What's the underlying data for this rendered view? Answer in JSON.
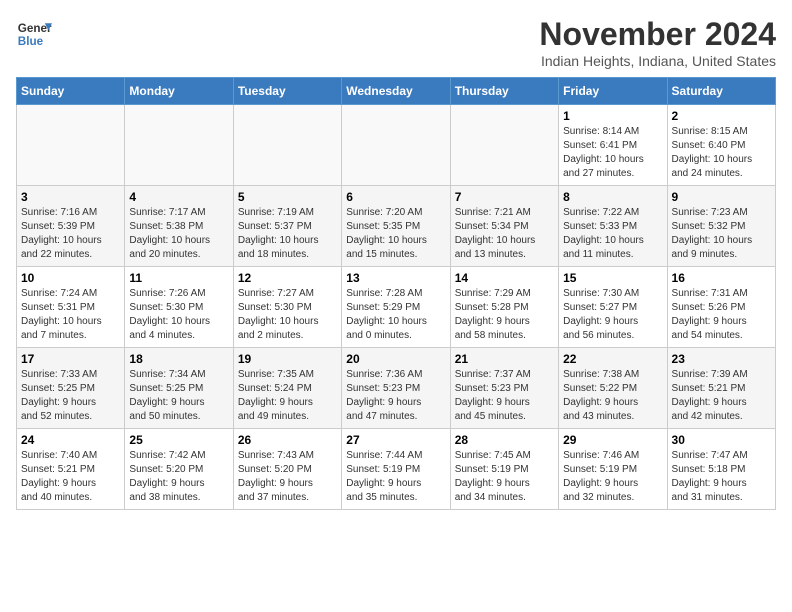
{
  "header": {
    "logo": {
      "line1": "General",
      "line2": "Blue"
    },
    "title": "November 2024",
    "location": "Indian Heights, Indiana, United States"
  },
  "weekdays": [
    "Sunday",
    "Monday",
    "Tuesday",
    "Wednesday",
    "Thursday",
    "Friday",
    "Saturday"
  ],
  "weeks": [
    [
      {
        "day": "",
        "info": ""
      },
      {
        "day": "",
        "info": ""
      },
      {
        "day": "",
        "info": ""
      },
      {
        "day": "",
        "info": ""
      },
      {
        "day": "",
        "info": ""
      },
      {
        "day": "1",
        "info": "Sunrise: 8:14 AM\nSunset: 6:41 PM\nDaylight: 10 hours\nand 27 minutes."
      },
      {
        "day": "2",
        "info": "Sunrise: 8:15 AM\nSunset: 6:40 PM\nDaylight: 10 hours\nand 24 minutes."
      }
    ],
    [
      {
        "day": "3",
        "info": "Sunrise: 7:16 AM\nSunset: 5:39 PM\nDaylight: 10 hours\nand 22 minutes."
      },
      {
        "day": "4",
        "info": "Sunrise: 7:17 AM\nSunset: 5:38 PM\nDaylight: 10 hours\nand 20 minutes."
      },
      {
        "day": "5",
        "info": "Sunrise: 7:19 AM\nSunset: 5:37 PM\nDaylight: 10 hours\nand 18 minutes."
      },
      {
        "day": "6",
        "info": "Sunrise: 7:20 AM\nSunset: 5:35 PM\nDaylight: 10 hours\nand 15 minutes."
      },
      {
        "day": "7",
        "info": "Sunrise: 7:21 AM\nSunset: 5:34 PM\nDaylight: 10 hours\nand 13 minutes."
      },
      {
        "day": "8",
        "info": "Sunrise: 7:22 AM\nSunset: 5:33 PM\nDaylight: 10 hours\nand 11 minutes."
      },
      {
        "day": "9",
        "info": "Sunrise: 7:23 AM\nSunset: 5:32 PM\nDaylight: 10 hours\nand 9 minutes."
      }
    ],
    [
      {
        "day": "10",
        "info": "Sunrise: 7:24 AM\nSunset: 5:31 PM\nDaylight: 10 hours\nand 7 minutes."
      },
      {
        "day": "11",
        "info": "Sunrise: 7:26 AM\nSunset: 5:30 PM\nDaylight: 10 hours\nand 4 minutes."
      },
      {
        "day": "12",
        "info": "Sunrise: 7:27 AM\nSunset: 5:30 PM\nDaylight: 10 hours\nand 2 minutes."
      },
      {
        "day": "13",
        "info": "Sunrise: 7:28 AM\nSunset: 5:29 PM\nDaylight: 10 hours\nand 0 minutes."
      },
      {
        "day": "14",
        "info": "Sunrise: 7:29 AM\nSunset: 5:28 PM\nDaylight: 9 hours\nand 58 minutes."
      },
      {
        "day": "15",
        "info": "Sunrise: 7:30 AM\nSunset: 5:27 PM\nDaylight: 9 hours\nand 56 minutes."
      },
      {
        "day": "16",
        "info": "Sunrise: 7:31 AM\nSunset: 5:26 PM\nDaylight: 9 hours\nand 54 minutes."
      }
    ],
    [
      {
        "day": "17",
        "info": "Sunrise: 7:33 AM\nSunset: 5:25 PM\nDaylight: 9 hours\nand 52 minutes."
      },
      {
        "day": "18",
        "info": "Sunrise: 7:34 AM\nSunset: 5:25 PM\nDaylight: 9 hours\nand 50 minutes."
      },
      {
        "day": "19",
        "info": "Sunrise: 7:35 AM\nSunset: 5:24 PM\nDaylight: 9 hours\nand 49 minutes."
      },
      {
        "day": "20",
        "info": "Sunrise: 7:36 AM\nSunset: 5:23 PM\nDaylight: 9 hours\nand 47 minutes."
      },
      {
        "day": "21",
        "info": "Sunrise: 7:37 AM\nSunset: 5:23 PM\nDaylight: 9 hours\nand 45 minutes."
      },
      {
        "day": "22",
        "info": "Sunrise: 7:38 AM\nSunset: 5:22 PM\nDaylight: 9 hours\nand 43 minutes."
      },
      {
        "day": "23",
        "info": "Sunrise: 7:39 AM\nSunset: 5:21 PM\nDaylight: 9 hours\nand 42 minutes."
      }
    ],
    [
      {
        "day": "24",
        "info": "Sunrise: 7:40 AM\nSunset: 5:21 PM\nDaylight: 9 hours\nand 40 minutes."
      },
      {
        "day": "25",
        "info": "Sunrise: 7:42 AM\nSunset: 5:20 PM\nDaylight: 9 hours\nand 38 minutes."
      },
      {
        "day": "26",
        "info": "Sunrise: 7:43 AM\nSunset: 5:20 PM\nDaylight: 9 hours\nand 37 minutes."
      },
      {
        "day": "27",
        "info": "Sunrise: 7:44 AM\nSunset: 5:19 PM\nDaylight: 9 hours\nand 35 minutes."
      },
      {
        "day": "28",
        "info": "Sunrise: 7:45 AM\nSunset: 5:19 PM\nDaylight: 9 hours\nand 34 minutes."
      },
      {
        "day": "29",
        "info": "Sunrise: 7:46 AM\nSunset: 5:19 PM\nDaylight: 9 hours\nand 32 minutes."
      },
      {
        "day": "30",
        "info": "Sunrise: 7:47 AM\nSunset: 5:18 PM\nDaylight: 9 hours\nand 31 minutes."
      }
    ]
  ]
}
